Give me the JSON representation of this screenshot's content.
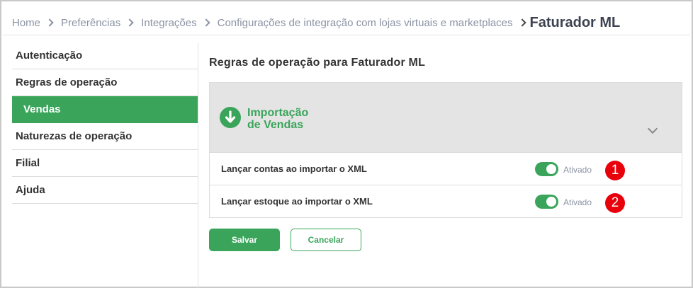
{
  "breadcrumb": {
    "items": [
      "Home",
      "Preferências",
      "Integrações",
      "Configurações de integração com lojas virtuais e marketplaces"
    ],
    "current": "Faturador ML"
  },
  "sidebar": {
    "items": [
      {
        "label": "Autenticação"
      },
      {
        "label": "Regras de operação"
      },
      {
        "label": "Vendas",
        "active": true
      },
      {
        "label": "Naturezas de operação"
      },
      {
        "label": "Filial"
      },
      {
        "label": "Ajuda"
      }
    ]
  },
  "main": {
    "title": "Regras de operação para Faturador ML",
    "panel": {
      "title_line1": "Importação",
      "title_line2": "de Vendas",
      "icon": "arrow-down-circle-icon"
    },
    "rows": [
      {
        "label": "Lançar contas ao importar o XML",
        "state": "Ativado",
        "enabled": true,
        "marker": "1"
      },
      {
        "label": "Lançar estoque ao importar o XML",
        "state": "Ativado",
        "enabled": true,
        "marker": "2"
      }
    ]
  },
  "actions": {
    "save_label": "Salvar",
    "cancel_label": "Cancelar"
  },
  "colors": {
    "accent": "#3aa55a",
    "marker": "#e8000b",
    "muted_text": "#8a93a3"
  }
}
